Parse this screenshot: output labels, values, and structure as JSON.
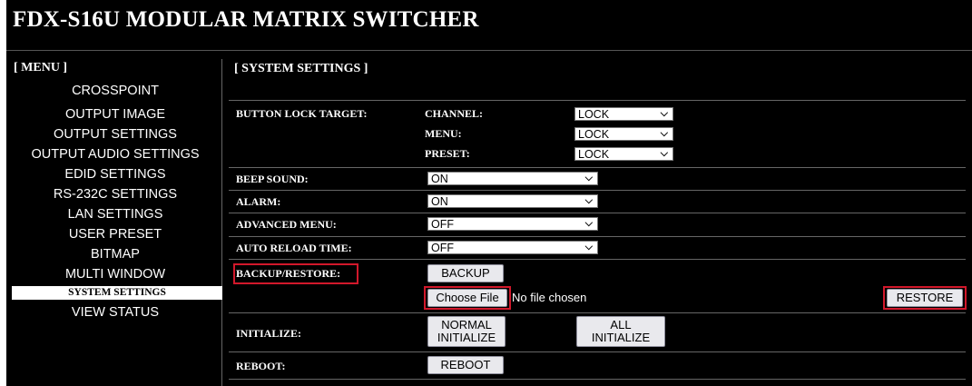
{
  "header": {
    "title": "FDX-S16U MODULAR MATRIX SWITCHER"
  },
  "menu": {
    "title": "[ MENU ]",
    "items": [
      {
        "label": "CROSSPOINT"
      },
      {
        "label": "OUTPUT IMAGE"
      },
      {
        "label": "OUTPUT SETTINGS"
      },
      {
        "label": "OUTPUT AUDIO SETTINGS"
      },
      {
        "label": "EDID SETTINGS"
      },
      {
        "label": "RS-232C SETTINGS"
      },
      {
        "label": "LAN SETTINGS"
      },
      {
        "label": "USER PRESET"
      },
      {
        "label": "BITMAP"
      },
      {
        "label": "MULTI WINDOW"
      },
      {
        "label": "SYSTEM SETTINGS",
        "active": true
      },
      {
        "label": "VIEW STATUS"
      }
    ]
  },
  "settings": {
    "section_title": "[ SYSTEM SETTINGS ]",
    "button_lock": {
      "label": "BUTTON LOCK TARGET:",
      "channel_label": "CHANNEL:",
      "channel_value": "LOCK",
      "menu_label": "MENU:",
      "menu_value": "LOCK",
      "preset_label": "PRESET:",
      "preset_value": "LOCK"
    },
    "beep": {
      "label": "BEEP SOUND:",
      "value": "ON"
    },
    "alarm": {
      "label": "ALARM:",
      "value": "ON"
    },
    "advanced": {
      "label": "ADVANCED MENU:",
      "value": "OFF"
    },
    "auto_reload": {
      "label": "AUTO RELOAD TIME:",
      "value": "OFF"
    },
    "backup": {
      "label": "BACKUP/RESTORE:",
      "backup_button": "BACKUP",
      "choose_file_button": "Choose File",
      "file_status": "No file chosen",
      "restore_button": "RESTORE"
    },
    "initialize": {
      "label": "INITIALIZE:",
      "normal_line1": "NORMAL",
      "normal_line2": "INITIALIZE",
      "all_line1": "ALL",
      "all_line2": "INITIALIZE"
    },
    "reboot": {
      "label": "REBOOT:",
      "button": "REBOOT"
    }
  },
  "colors": {
    "background": "#000000",
    "highlight": "#d2182b",
    "button": "#e9e9ed"
  },
  "icons": {
    "select_arrow": "chevron-down-icon"
  }
}
